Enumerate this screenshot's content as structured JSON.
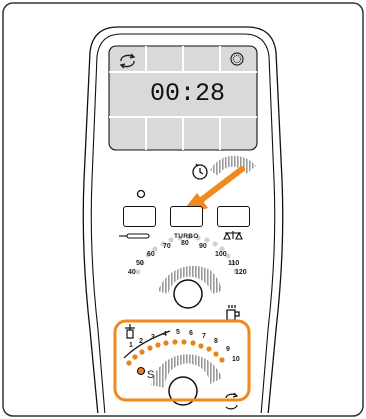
{
  "display": {
    "time": "00:28",
    "sync_icon": "rotating-arrows-icon",
    "clock_icon": "clock-face-icon"
  },
  "buttons": {
    "left_icon": "whisk-icon",
    "turbo_label": "TURBO",
    "right_icon": "scale-icon"
  },
  "speed_dial": {
    "labels": [
      "40",
      "50",
      "60",
      "70",
      "80",
      "90",
      "100",
      "110",
      "120"
    ]
  },
  "stir_dial": {
    "labels": [
      "1",
      "2",
      "3",
      "4",
      "5",
      "6",
      "7",
      "8",
      "9",
      "10"
    ],
    "soft_label": "S"
  },
  "icons": {
    "timer": "timer-icon",
    "kettle": "kettle-icon",
    "stir": "stir-icon",
    "reverse": "reverse-rotation-icon"
  },
  "colors": {
    "highlight": "#F08A1C",
    "dots": "#E8821A",
    "outline": "#111111",
    "lcd": "#D9D9D9",
    "page_border": "#333333"
  }
}
